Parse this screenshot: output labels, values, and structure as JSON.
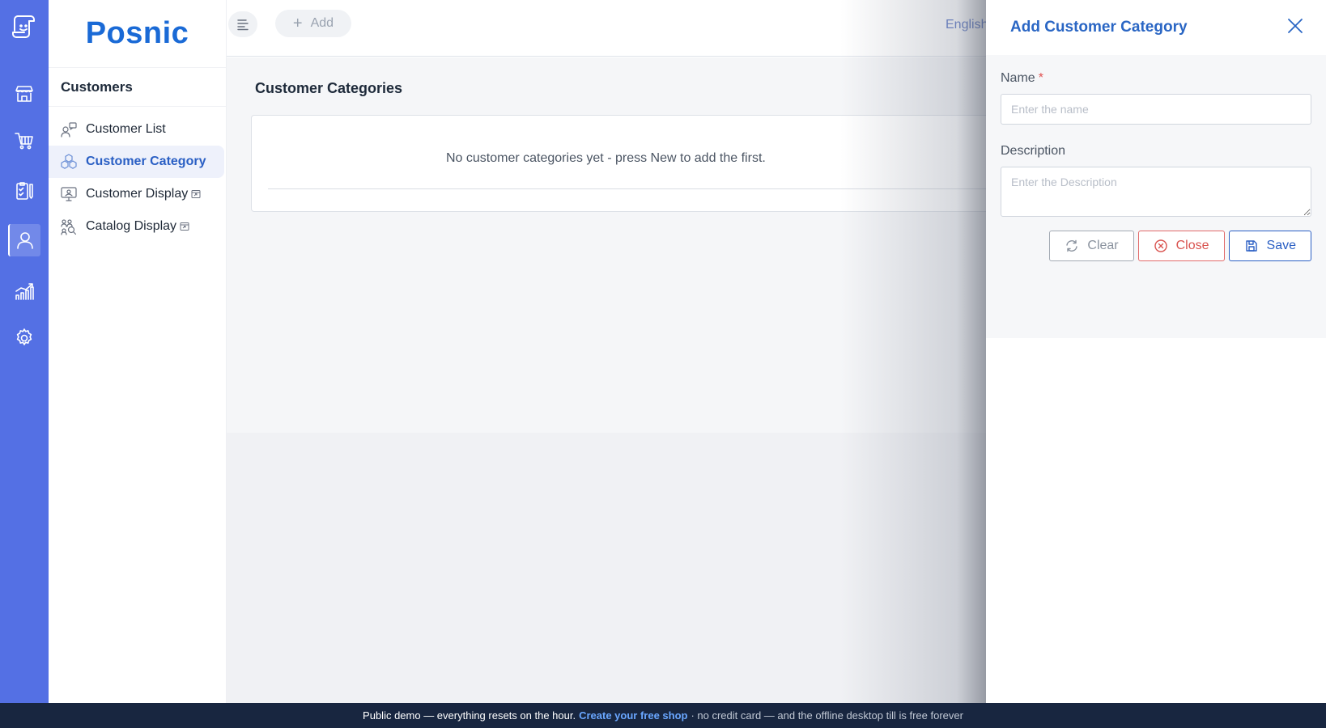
{
  "brand": {
    "name": "Posnic"
  },
  "sidebar": {
    "section_title": "Customers",
    "items": [
      {
        "label": "Customer List",
        "icon": "customer-list-icon",
        "external": false
      },
      {
        "label": "Customer Category",
        "icon": "customer-category-icon",
        "external": false,
        "active": true
      },
      {
        "label": "Customer Display",
        "icon": "customer-display-icon",
        "external": true
      },
      {
        "label": "Catalog Display",
        "icon": "catalog-display-icon",
        "external": true
      }
    ]
  },
  "rail": {
    "items": [
      "store-icon",
      "cart-icon",
      "clipboard-icon",
      "user-icon",
      "chart-icon",
      "gear-icon"
    ],
    "active_index": 3
  },
  "topbar": {
    "add_label": "Add",
    "language": "English"
  },
  "main": {
    "title": "Customer Categories",
    "empty_message": "No customer categories yet - press New to add the first."
  },
  "drawer": {
    "title": "Add Customer Category",
    "name_label": "Name",
    "name_required_mark": "*",
    "name_placeholder": "Enter the name",
    "name_value": "",
    "description_label": "Description",
    "description_placeholder": "Enter the Description",
    "description_value": "",
    "clear_label": "Clear",
    "close_label": "Close",
    "save_label": "Save"
  },
  "footer": {
    "prefix": "Public demo — everything resets on the hour.",
    "link": "Create your free shop",
    "suffix": "· no credit card — and the offline desktop till is free forever"
  },
  "colors": {
    "rail": "#5470e4",
    "brand": "#1a6ad6",
    "accent": "#2a5fc4",
    "danger": "#d9534f",
    "footer": "#182640"
  }
}
